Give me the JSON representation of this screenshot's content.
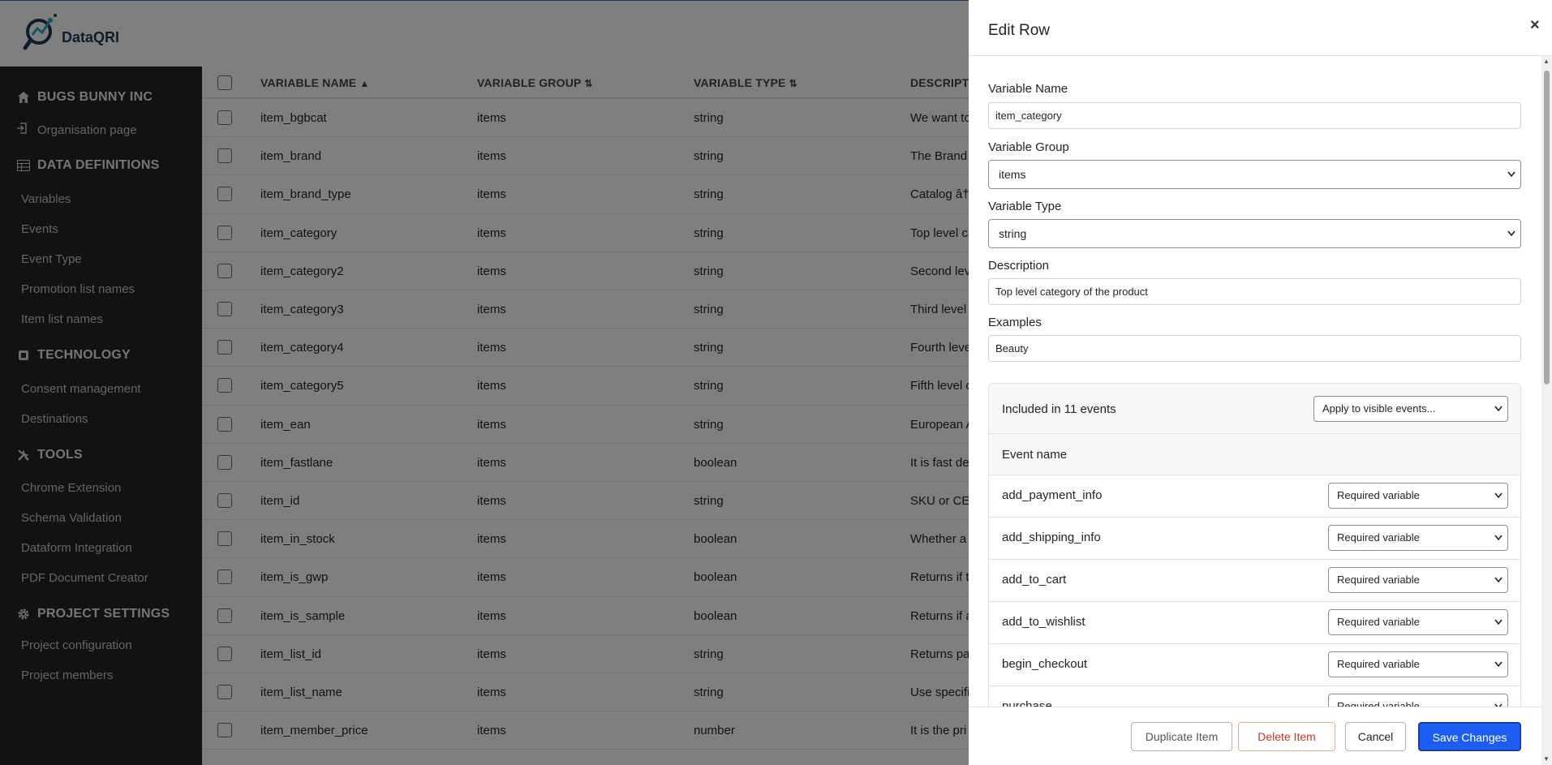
{
  "app": {
    "name": "DataQRI"
  },
  "sidebar": {
    "org_name": "BUGS BUNNY INC",
    "org_page": "Organisation page",
    "sections": [
      {
        "title": "DATA DEFINITIONS",
        "items": [
          "Variables",
          "Events",
          "Event Type",
          "Promotion list names",
          "Item list names"
        ]
      },
      {
        "title": "TECHNOLOGY",
        "items": [
          "Consent management",
          "Destinations"
        ]
      },
      {
        "title": "TOOLS",
        "items": [
          "Chrome Extension",
          "Schema Validation",
          "Dataform Integration",
          "PDF Document Creator"
        ]
      },
      {
        "title": "PROJECT SETTINGS",
        "items": [
          "Project configuration",
          "Project members"
        ]
      }
    ]
  },
  "table": {
    "headers": {
      "name": "VARIABLE NAME",
      "name_sort": "▲",
      "group": "VARIABLE GROUP",
      "group_sort": "⇅",
      "type": "VARIABLE TYPE",
      "type_sort": "⇅",
      "description": "DESCRIPTI"
    },
    "rows": [
      {
        "name": "item_bgbcat",
        "group": "items",
        "type": "string",
        "desc": "We want to"
      },
      {
        "name": "item_brand",
        "group": "items",
        "type": "string",
        "desc": "The Brand o"
      },
      {
        "name": "item_brand_type",
        "group": "items",
        "type": "string",
        "desc": "Catalog â†'"
      },
      {
        "name": "item_category",
        "group": "items",
        "type": "string",
        "desc": "Top level ca"
      },
      {
        "name": "item_category2",
        "group": "items",
        "type": "string",
        "desc": "Second leve"
      },
      {
        "name": "item_category3",
        "group": "items",
        "type": "string",
        "desc": "Third level"
      },
      {
        "name": "item_category4",
        "group": "items",
        "type": "string",
        "desc": "Fourth leve"
      },
      {
        "name": "item_category5",
        "group": "items",
        "type": "string",
        "desc": "Fifth level c"
      },
      {
        "name": "item_ean",
        "group": "items",
        "type": "string",
        "desc": "European A"
      },
      {
        "name": "item_fastlane",
        "group": "items",
        "type": "boolean",
        "desc": "It is fast de"
      },
      {
        "name": "item_id",
        "group": "items",
        "type": "string",
        "desc": "SKU or CE n"
      },
      {
        "name": "item_in_stock",
        "group": "items",
        "type": "boolean",
        "desc": "Whether a"
      },
      {
        "name": "item_is_gwp",
        "group": "items",
        "type": "boolean",
        "desc": "Returns if t"
      },
      {
        "name": "item_is_sample",
        "group": "items",
        "type": "boolean",
        "desc": "Returns if a"
      },
      {
        "name": "item_list_id",
        "group": "items",
        "type": "string",
        "desc": "Returns pag"
      },
      {
        "name": "item_list_name",
        "group": "items",
        "type": "string",
        "desc": "Use specifi"
      },
      {
        "name": "item_member_price",
        "group": "items",
        "type": "number",
        "desc": "It is the pri"
      }
    ]
  },
  "modal": {
    "title": "Edit Row",
    "close": "×",
    "fields": {
      "name_label": "Variable Name",
      "name_value": "item_category",
      "group_label": "Variable Group",
      "group_value": "items",
      "type_label": "Variable Type",
      "type_value": "string",
      "desc_label": "Description",
      "desc_value": "Top level category of the product",
      "examples_label": "Examples",
      "examples_value": "Beauty"
    },
    "events_card": {
      "title": "Included in 11 events",
      "apply_select": "Apply to visible events...",
      "column_header": "Event name",
      "rows": [
        {
          "name": "add_payment_info",
          "status": "Required variable"
        },
        {
          "name": "add_shipping_info",
          "status": "Required variable"
        },
        {
          "name": "add_to_cart",
          "status": "Required variable"
        },
        {
          "name": "add_to_wishlist",
          "status": "Required variable"
        },
        {
          "name": "begin_checkout",
          "status": "Required variable"
        },
        {
          "name": "purchase",
          "status": "Required variable"
        }
      ]
    },
    "buttons": {
      "duplicate": "Duplicate Item",
      "delete": "Delete Item",
      "cancel": "Cancel",
      "save": "Save Changes"
    }
  }
}
